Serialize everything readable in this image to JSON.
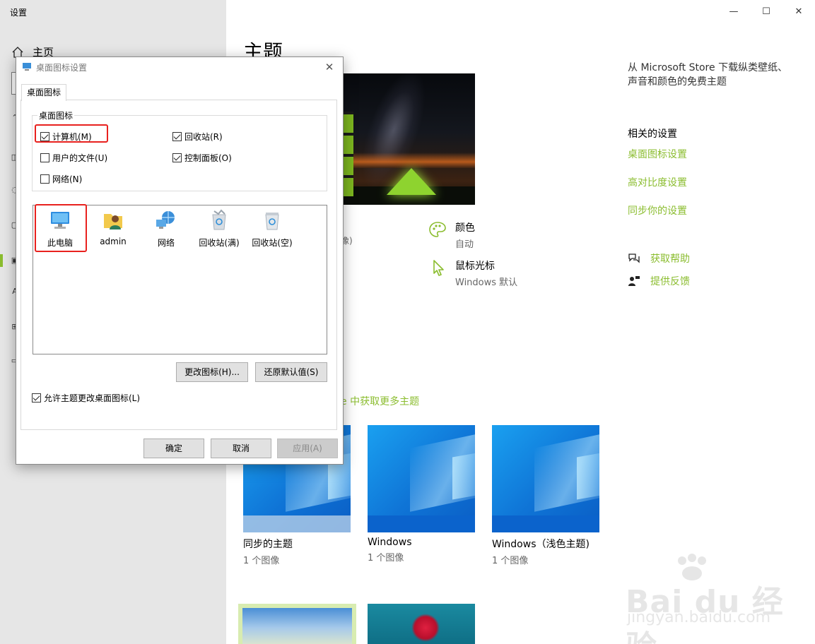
{
  "app": {
    "title": "设置",
    "window_controls": {
      "minimize": "—",
      "maximize": "☐",
      "close": "✕"
    }
  },
  "sidebar": {
    "home_label": "主页",
    "nav_icons": [
      "person-icon",
      "image-icon",
      "palette-icon",
      "lock-icon",
      "theme-icon",
      "font-icon",
      "start-icon",
      "taskbar-icon"
    ]
  },
  "main": {
    "title": "主题",
    "preview_caption": "像)",
    "color": {
      "title": "颜色",
      "value": "自动"
    },
    "cursor": {
      "title": "鼠标光标",
      "value": "Windows 默认"
    },
    "store_link": "e 中获取更多主题"
  },
  "right_panel": {
    "store_text": "从 Microsoft Store 下载纵类壁纸、声音和颜色的免费主题",
    "related_heading": "相关的设置",
    "links": [
      "桌面图标设置",
      "高对比度设置",
      "同步你的设置"
    ],
    "get_help": "获取帮助",
    "feedback": "提供反馈"
  },
  "themes": [
    {
      "name": "同步的主题",
      "count": "1 个图像"
    },
    {
      "name": "Windows",
      "count": "1 个图像"
    },
    {
      "name": "Windows（浅色主题)",
      "count": "1 个图像"
    }
  ],
  "watermark": {
    "brand": "Bai du 经验",
    "url": "jingyan.baidu.com"
  },
  "dialog": {
    "title": "桌面图标设置",
    "tab": "桌面图标",
    "group_title": "桌面图标",
    "checkboxes": [
      {
        "label": "计算机(M)",
        "checked": true
      },
      {
        "label": "回收站(R)",
        "checked": true
      },
      {
        "label": "用户的文件(U)",
        "checked": false
      },
      {
        "label": "控制面板(O)",
        "checked": true
      },
      {
        "label": "网络(N)",
        "checked": false
      }
    ],
    "icons": [
      "此电脑",
      "admin",
      "网络",
      "回收站(满)",
      "回收站(空)"
    ],
    "change_icon_button": "更改图标(H)...",
    "restore_default_button": "还原默认值(S)",
    "allow_theme_checkbox": {
      "label": "允许主题更改桌面图标(L)",
      "checked": true
    },
    "ok_button": "确定",
    "cancel_button": "取消",
    "apply_button": "应用(A)"
  },
  "colors": {
    "accent": "#8bbd2f",
    "highlight": "#e8211e",
    "sidebar_bg": "#e6e6e6"
  }
}
